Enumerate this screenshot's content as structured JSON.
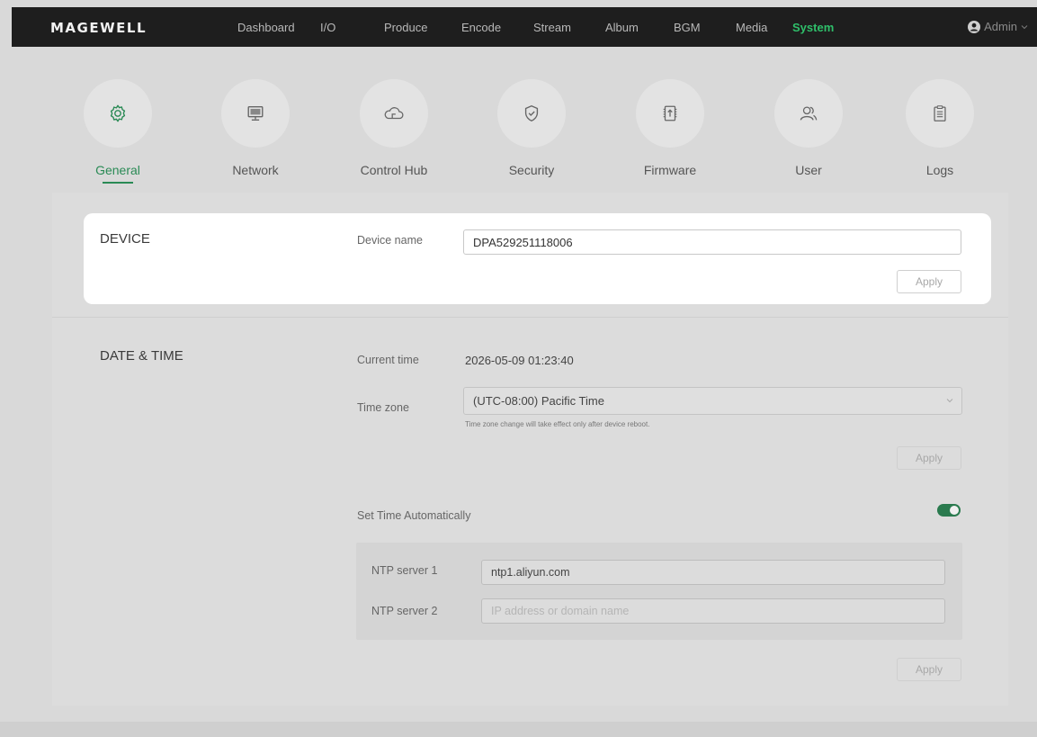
{
  "topbar": {
    "logo": "MAGEWELL",
    "nav": [
      "Dashboard",
      "I/O",
      "Produce",
      "Encode",
      "Stream",
      "Album",
      "BGM",
      "Media",
      "System"
    ],
    "active_nav": "System",
    "user": "Admin"
  },
  "tabs": [
    {
      "label": "General",
      "icon": "gear-icon"
    },
    {
      "label": "Network",
      "icon": "monitor-icon"
    },
    {
      "label": "Control Hub",
      "icon": "cloud-icon"
    },
    {
      "label": "Security",
      "icon": "shield-check-icon"
    },
    {
      "label": "Firmware",
      "icon": "firmware-upload-icon"
    },
    {
      "label": "User",
      "icon": "users-icon"
    },
    {
      "label": "Logs",
      "icon": "clipboard-icon"
    }
  ],
  "active_tab": "General",
  "device": {
    "title": "DEVICE",
    "device_name_label": "Device name",
    "device_name_value": "DPA529251118006",
    "apply_label": "Apply"
  },
  "datetime": {
    "title": "DATE & TIME",
    "current_time_label": "Current time",
    "current_time_value": "2026-05-09 01:23:40",
    "timezone_label": "Time zone",
    "timezone_value": "(UTC-08:00) Pacific Time",
    "timezone_hint": "Time zone change will take effect only after device reboot.",
    "apply_label": "Apply",
    "auto_label": "Set Time Automatically",
    "auto_enabled": true,
    "ntp1_label": "NTP server 1",
    "ntp1_value": "ntp1.aliyun.com",
    "ntp2_label": "NTP server 2",
    "ntp2_placeholder": "IP address or domain name",
    "ntp_apply_label": "Apply"
  },
  "colors": {
    "accent": "#2a8a55",
    "nav_active": "#2fbf6a",
    "topbar_bg": "#1e1e1e"
  }
}
